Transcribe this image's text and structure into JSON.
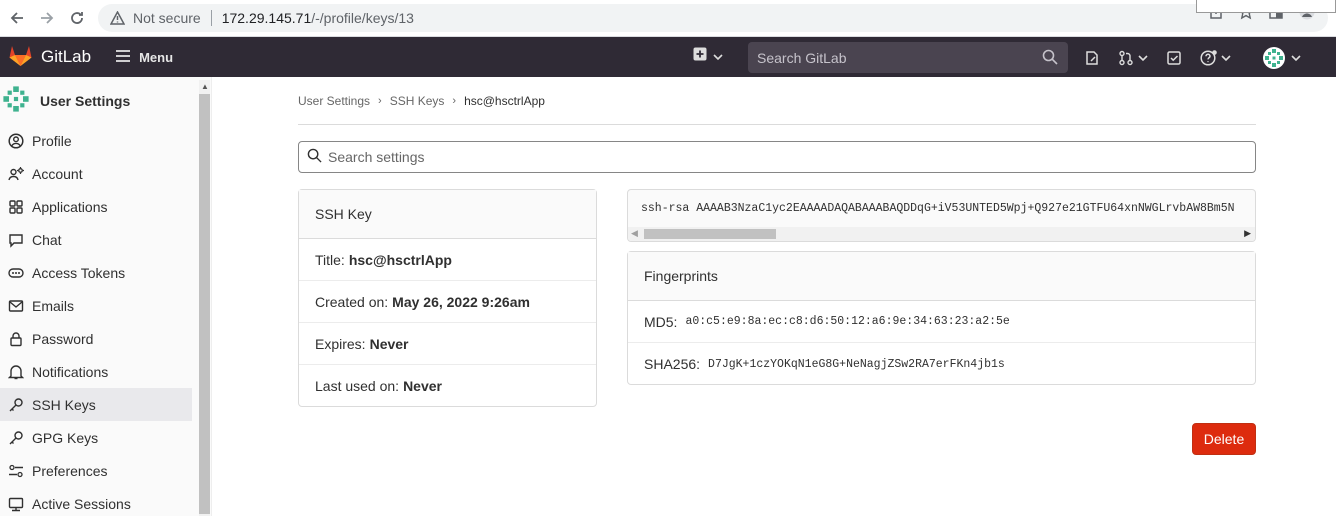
{
  "browser": {
    "security_label": "Not secure",
    "url_host": "172.29.145.71",
    "url_path": "/-/profile/keys/13"
  },
  "topbar": {
    "app_name": "GitLab",
    "menu_label": "Menu",
    "search_placeholder": "Search GitLab"
  },
  "sidebar": {
    "title": "User Settings",
    "items": [
      {
        "label": "Profile",
        "icon": "profile-icon"
      },
      {
        "label": "Account",
        "icon": "account-icon"
      },
      {
        "label": "Applications",
        "icon": "applications-icon"
      },
      {
        "label": "Chat",
        "icon": "chat-icon"
      },
      {
        "label": "Access Tokens",
        "icon": "token-icon"
      },
      {
        "label": "Emails",
        "icon": "mail-icon"
      },
      {
        "label": "Password",
        "icon": "lock-icon"
      },
      {
        "label": "Notifications",
        "icon": "bell-icon"
      },
      {
        "label": "SSH Keys",
        "icon": "key-icon",
        "active": true
      },
      {
        "label": "GPG Keys",
        "icon": "key-icon"
      },
      {
        "label": "Preferences",
        "icon": "preferences-icon"
      },
      {
        "label": "Active Sessions",
        "icon": "sessions-icon"
      }
    ]
  },
  "breadcrumb": {
    "items": [
      "User Settings",
      "SSH Keys",
      "hsc@hsctrlApp"
    ]
  },
  "settings_search": {
    "placeholder": "Search settings"
  },
  "key_card": {
    "header": "SSH Key",
    "title_label": "Title:",
    "title_value": "hsc@hsctrlApp",
    "created_label": "Created on:",
    "created_value": "May 26, 2022 9:26am",
    "expires_label": "Expires:",
    "expires_value": "Never",
    "last_used_label": "Last used on:",
    "last_used_value": "Never"
  },
  "key_text": "ssh-rsa AAAAB3NzaC1yc2EAAAADAQABAAABAQDDqG+iV53UNTED5Wpj+Q927e21GTFU64xnNWGLrvbAW8Bm5N",
  "fingerprints": {
    "header": "Fingerprints",
    "md5_label": "MD5:",
    "md5_value": "a0:c5:e9:8a:ec:c8:d6:50:12:a6:9e:34:63:23:a2:5e",
    "sha256_label": "SHA256:",
    "sha256_value": "D7JgK+1czYOKqN1eG8G+NeNagjZSw2RA7erFKn4jb1s"
  },
  "actions": {
    "delete_label": "Delete"
  },
  "colors": {
    "topbar_bg": "#2f2a35",
    "delete_bg": "#dd2b0e",
    "gitlab_orange": "#e24329"
  }
}
